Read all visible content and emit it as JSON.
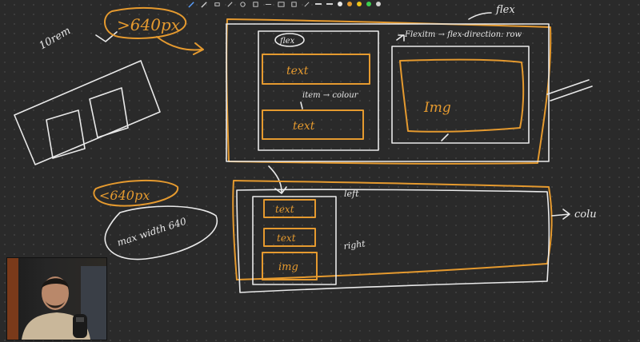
{
  "toolbar": {
    "tools": [
      "pen-icon",
      "highlighter-icon",
      "eraser-icon",
      "pencil-icon",
      "lasso-icon",
      "shape-icon",
      "line-icon",
      "image-icon",
      "sticky-icon",
      "link-icon"
    ],
    "colors": [
      "#e8e8e8",
      "#9a9a9a",
      "#e59a2f",
      "#f0c419",
      "#3ccf4e",
      "#cfcfcf"
    ]
  },
  "notes": {
    "ten_rem": "10rem",
    "gt_640": ">640px",
    "flex_label": "flex",
    "text_1": "text",
    "item_colour": "item → colour",
    "text_2": "text",
    "img_label": "Img",
    "flex_row": "Flexitm → flex-direction: row",
    "flex_top": "flex",
    "lt_640": "<640px",
    "max_width": "max width 640",
    "left": "left",
    "right": "right",
    "text_3": "text",
    "text_4": "text",
    "img_small": "img",
    "colu": "colu"
  },
  "colors": {
    "background": "#2a2a2a",
    "ink_orange": "#e59a2f",
    "ink_white": "#e9e9e9"
  }
}
